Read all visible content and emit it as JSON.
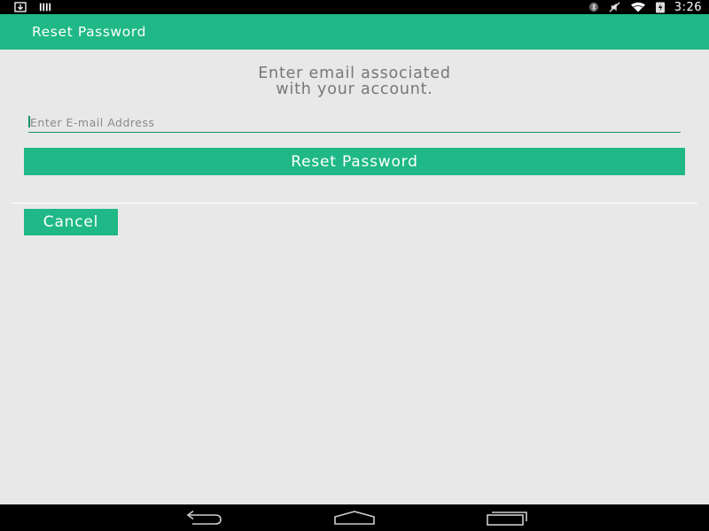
{
  "status_bar": {
    "time": "3:26",
    "icons": [
      "download-notification-icon",
      "signal-bars-notification-icon",
      "bluetooth-icon",
      "mute-icon",
      "wifi-icon",
      "battery-charging-icon"
    ]
  },
  "app_bar": {
    "title": "Reset Password"
  },
  "form": {
    "instruction_line1": "Enter email associated",
    "instruction_line2": "with your account.",
    "email_placeholder": "Enter E-mail Address",
    "email_value": "",
    "reset_button_label": "Reset Password",
    "cancel_button_label": "Cancel"
  },
  "nav_bar": {
    "icons": [
      "back-icon",
      "home-icon",
      "recents-icon"
    ]
  },
  "colors": {
    "accent": "#1fb886",
    "background": "#e8e8e8",
    "instruction_text": "#777777"
  }
}
